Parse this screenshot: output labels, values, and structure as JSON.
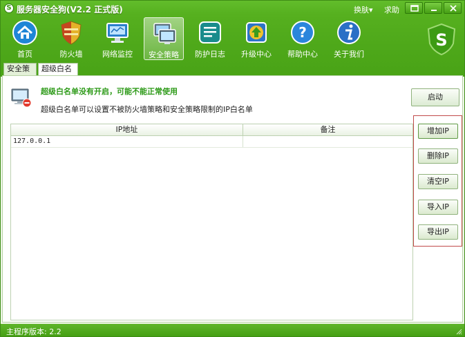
{
  "window": {
    "title": "服务器安全狗(V2.2 正式版)",
    "skin_label": "换肤▾",
    "help_label": "求助"
  },
  "toolbar": {
    "items": [
      {
        "label": "首页",
        "icon": "home-icon"
      },
      {
        "label": "防火墙",
        "icon": "shield-icon"
      },
      {
        "label": "网络监控",
        "icon": "network-monitor-icon"
      },
      {
        "label": "安全策略",
        "icon": "security-policy-icon"
      },
      {
        "label": "防护日志",
        "icon": "log-icon"
      },
      {
        "label": "升级中心",
        "icon": "upgrade-icon"
      },
      {
        "label": "帮助中心",
        "icon": "help-icon"
      },
      {
        "label": "关于我们",
        "icon": "about-icon"
      }
    ],
    "active_index": 3
  },
  "tabs": [
    {
      "label": "安全策略"
    },
    {
      "label": "超级白名单"
    }
  ],
  "whitelist": {
    "warning": "超级白名单没有开启，可能不能正常使用",
    "description": "超级白名单可以设置不被防火墙策略和安全策略限制的IP白名单",
    "start_button": "启动",
    "columns": [
      "IP地址",
      "备注"
    ],
    "rows": [
      {
        "ip": "127.0.0.1",
        "note": ""
      }
    ],
    "actions": [
      "增加IP",
      "删除IP",
      "清空IP",
      "导入IP",
      "导出IP"
    ]
  },
  "status": {
    "version_text": "主程序版本: 2.2"
  },
  "colors": {
    "brand_green": "#4ea81a",
    "warning_green": "#2d9a18",
    "action_border": "#c14a4a"
  }
}
